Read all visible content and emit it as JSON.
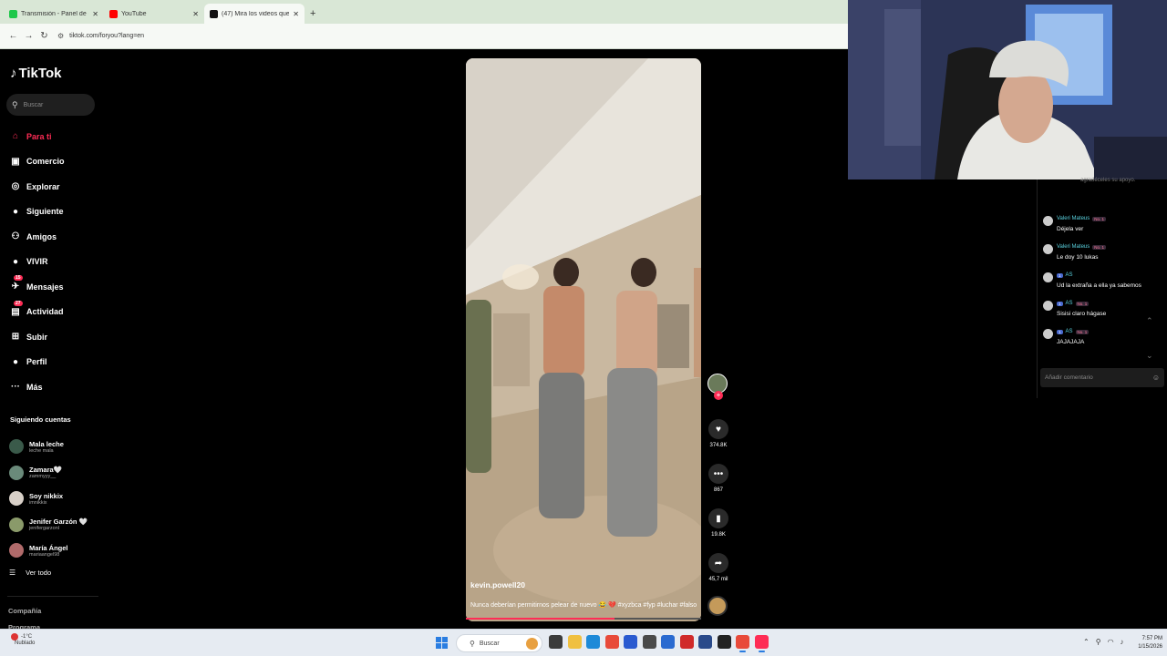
{
  "browser": {
    "tabs": [
      {
        "label": "Transmisión - Panel de control",
        "color": "#1ec84a"
      },
      {
        "label": "YouTube",
        "color": "#ff0000"
      },
      {
        "label": "(47) Mira los videos que son ten",
        "color": "#111111"
      }
    ],
    "new_tab": "+",
    "url": "tiktok.com/foryou?lang=en"
  },
  "tiktok": {
    "logo": "TikTok",
    "search_placeholder": "Buscar",
    "nav": [
      {
        "label": "Para ti",
        "icon": "home-icon",
        "glyph": "⌂",
        "active": true
      },
      {
        "label": "Comercio",
        "icon": "shop-icon",
        "glyph": "▣"
      },
      {
        "label": "Explorar",
        "icon": "compass-icon",
        "glyph": "◎"
      },
      {
        "label": "Siguiente",
        "icon": "following-avatar-icon",
        "glyph": "●"
      },
      {
        "label": "Amigos",
        "icon": "friends-icon",
        "glyph": "⚇"
      },
      {
        "label": "VIVIR",
        "icon": "live-avatar-icon",
        "glyph": "●"
      },
      {
        "label": "Mensajes",
        "icon": "message-icon",
        "glyph": "✈",
        "badge": "15"
      },
      {
        "label": "Actividad",
        "icon": "activity-icon",
        "glyph": "▤",
        "badge": "27"
      },
      {
        "label": "Subir",
        "icon": "upload-icon",
        "glyph": "⊞"
      },
      {
        "label": "Perfil",
        "icon": "profile-icon",
        "glyph": "●"
      },
      {
        "label": "Más",
        "icon": "more-icon",
        "glyph": "···"
      }
    ],
    "following_title": "Siguiendo cuentas",
    "following": [
      {
        "name": "Mala leche",
        "user": "leche mala",
        "color": "#3a5a4a"
      },
      {
        "name": "Zamara🤍",
        "user": "zammyyy__",
        "color": "#6a8a7a"
      },
      {
        "name": "Soy nikkix",
        "user": "imnikkix",
        "color": "#d8d0c8"
      },
      {
        "name": "Jenifer Garzón 🤍",
        "user": "jenifergarzonl",
        "color": "#8a9a6a"
      },
      {
        "name": "María Ángel",
        "user": "mariaangel98",
        "color": "#b06a6a"
      }
    ],
    "see_all": "Ver todo",
    "company": "Compañía",
    "program": "Programa"
  },
  "video": {
    "username": "kevin.powell20",
    "caption": "Nunca deberían permitirnos pelear de nuevo 😂 💔 #xyzbca #fyp #luchar #falso",
    "progress": 0.63,
    "likes": "374.8K",
    "comments": "867",
    "saves": "19.8K",
    "shares": "45,7 mil",
    "plus": "+"
  },
  "chat": {
    "top_note": "agradéceles su apoyo.",
    "messages": [
      {
        "name": "Valeri Mateus",
        "tag": "No. 1",
        "level": "",
        "text": "Déjela ver"
      },
      {
        "name": "Valeri Mateus",
        "tag": "No. 1",
        "level": "",
        "text": "Le doy 10 lukas"
      },
      {
        "name": "AS",
        "tag": "",
        "level": "1",
        "text": "Ud la extraña a ella ya sabemos"
      },
      {
        "name": "AS",
        "tag": "No. 1",
        "level": "1",
        "text": "Sisisi claro hágase"
      },
      {
        "name": "AS",
        "tag": "No. 1",
        "level": "1",
        "text": "JAJAJAJA"
      }
    ],
    "input_placeholder": "Añadir comentario"
  },
  "taskbar": {
    "temp": "-1°C",
    "condition": "Nublado",
    "search": "Buscar",
    "time": "7:57 PM",
    "date": "1/15/2026",
    "apps": [
      {
        "icon": "task-view-icon",
        "color": "#3b3b3b"
      },
      {
        "icon": "file-explorer-icon",
        "color": "#f0c040"
      },
      {
        "icon": "edge-icon",
        "color": "#1e8ad8"
      },
      {
        "icon": "chrome-icon",
        "color": "#e84a3a"
      },
      {
        "icon": "store-icon",
        "color": "#2a5ad0"
      },
      {
        "icon": "calculator-icon",
        "color": "#4a4a4a"
      },
      {
        "icon": "app-a-icon",
        "color": "#2a6ad0"
      },
      {
        "icon": "app-l-icon",
        "color": "#d02a2a"
      },
      {
        "icon": "powershell-icon",
        "color": "#2a4a8a"
      },
      {
        "icon": "obs-icon",
        "color": "#222222"
      },
      {
        "icon": "chrome-active-icon",
        "color": "#e84a3a"
      },
      {
        "icon": "tiktok-app-icon",
        "color": "#fe2c55"
      }
    ]
  }
}
